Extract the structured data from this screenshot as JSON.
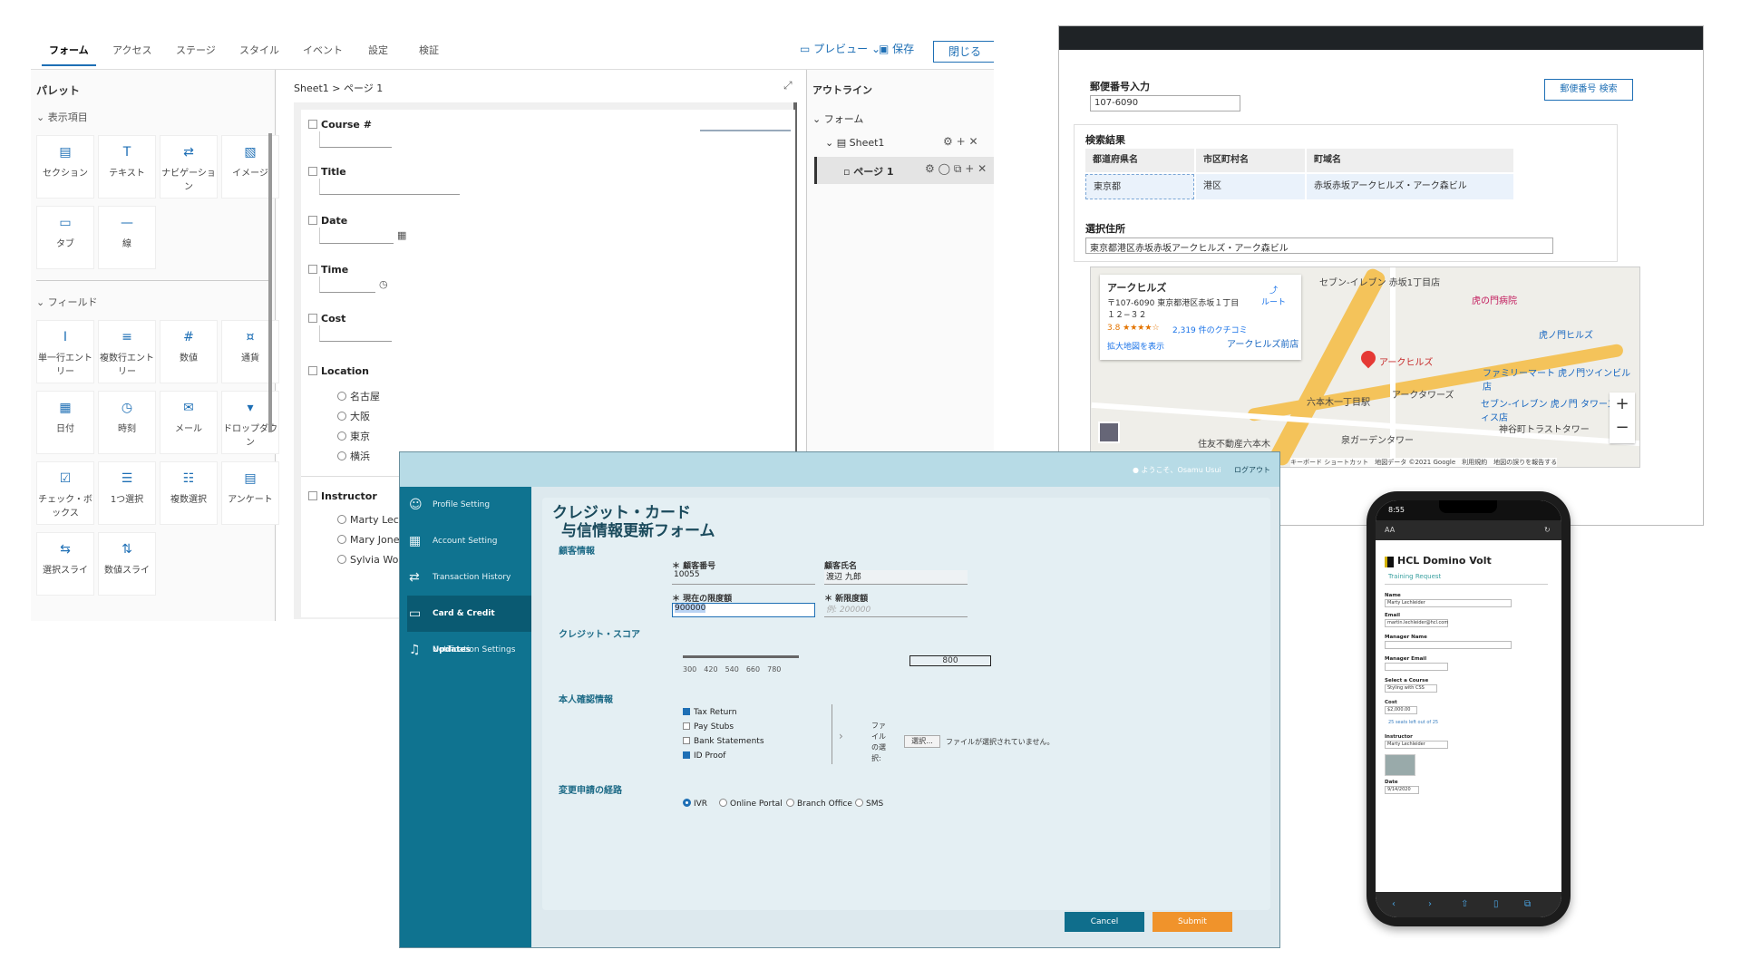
{
  "builder": {
    "tabs": [
      "フォーム",
      "アクセス",
      "ステージ",
      "スタイル",
      "イベント",
      "設定",
      "検証"
    ],
    "preview_label": "プレビュー",
    "save_label": "保存",
    "close_label": "閉じる",
    "palette_title": "パレット",
    "display_section": "表示項目",
    "display_items": [
      "セクション",
      "テキスト",
      "ナビゲーション",
      "イメージ",
      "タブ",
      "線"
    ],
    "field_section": "フィールド",
    "field_items": [
      "単一行エントリー",
      "複数行エントリー",
      "数値",
      "通貨",
      "日付",
      "時刻",
      "メール",
      "ドロップダウン",
      "チェック・ボックス",
      "1つ選択",
      "複数選択",
      "アンケート",
      "選択スライ",
      "数値スライ"
    ],
    "canvas_title": "Sheet1 > ページ 1",
    "fields": [
      "Course #",
      "Title",
      "Date",
      "Time",
      "Cost",
      "Location",
      "Instructor"
    ],
    "location_options": [
      "名古屋",
      "大阪",
      "東京",
      "横浜"
    ],
    "instructor_options": [
      "Marty Lechle",
      "Mary Jones",
      "Sylvia Woods"
    ],
    "outline_title": "アウトライン",
    "outline_items": [
      "フォーム",
      "Sheet1",
      "ページ 1"
    ]
  },
  "postal": {
    "zip_label": "郵便番号入力",
    "zip_value": "107-6090",
    "search_button": "郵便番号 検索",
    "results_title": "検索結果",
    "columns": [
      "都道府県名",
      "市区町村名",
      "町域名"
    ],
    "row": [
      "東京都",
      "港区",
      "赤坂赤坂アークヒルズ・アーク森ビル"
    ],
    "selected_label": "選択住所",
    "selected_value": "東京都港区赤坂赤坂アークヒルズ・アーク森ビル",
    "map_card_title": "アークヒルズ",
    "map_card_address": "〒107-6090 東京都港区赤坂１丁目 １２−３２",
    "map_card_rating": "3.8 ★★★★☆",
    "map_card_reviews": "2,319 件のクチコミ",
    "map_card_link": "拡大地図を表示",
    "map_route": "ルート",
    "map_labels": [
      "セブン-イレブン 赤坂1丁目店",
      "虎の門病院",
      "アークヒルズ",
      "アークタワーズ",
      "ファミリーマート 虎ノ門ツインビル店",
      "六本木一丁目駅",
      "セブン-イレブン 虎ノ門 タワーズオフィス店",
      "神谷町トラストタワー",
      "泉ガーデンタワー",
      "住友不動産六本木",
      "虎ノ門ヒルズ",
      "アークヒルズ前店"
    ],
    "map_footer": "キーボード ショートカット　地図データ ©2021 Google　利用規約　地図の誤りを報告する"
  },
  "credit": {
    "welcome": "ようこそ、Osamu Usui",
    "logout": "ログアウト",
    "nav": [
      "Profile Setting",
      "Account Setting",
      "Transaction History",
      "Card & Credit Updates",
      "Notification Settings"
    ],
    "title1": "クレジット・カード",
    "title2": "与信情報更新フォーム",
    "sec_customer": "顧客情報",
    "lbl_custno": "＊ 顧客番号",
    "custno": "10055",
    "lbl_custname": "顧客氏名",
    "custname": "渡辺 九郎",
    "lbl_limit": "＊ 現在の限度額",
    "limit": "900000",
    "lbl_newlimit": "＊ 新限度額",
    "newlimit_ph": "例: 200000",
    "sec_score": "クレジット・スコア",
    "ticks": [
      "300",
      "420",
      "540",
      "660",
      "780"
    ],
    "score": "800",
    "sec_id": "本人確認情報",
    "docs": [
      {
        "label": "Tax Return",
        "checked": true
      },
      {
        "label": "Pay Stubs",
        "checked": false
      },
      {
        "label": "Bank Statements",
        "checked": false
      },
      {
        "label": "ID Proof",
        "checked": true
      }
    ],
    "file_label": "ファイルの選択:",
    "file_btn": "選択...",
    "file_none": "ファイルが選択されていません。",
    "sec_route": "変更申請の経路",
    "routes": [
      "IVR",
      "Online Portal",
      "Branch Office",
      "SMS"
    ],
    "cancel": "Cancel",
    "submit": "Submit",
    "colors": {
      "sidebar": "#0f7390",
      "cancel": "#0f6e8c",
      "submit": "#f0932b"
    }
  },
  "phone": {
    "time": "8:55",
    "url": "AA",
    "app_title": "HCL Domino Volt",
    "subtitle": "Training Request",
    "fields": [
      {
        "label": "Name",
        "value": "Marty Lechleider"
      },
      {
        "label": "Email",
        "value": "martin.lechleider@hcl.com"
      },
      {
        "label": "Manager Name",
        "value": ""
      },
      {
        "label": "Manager Email",
        "value": ""
      },
      {
        "label": "Select a Course",
        "value": "Styling with CSS"
      },
      {
        "label": "Cost",
        "value": "$2,000.00"
      }
    ],
    "seats": "25 seats left out of 25",
    "instructor_label": "Instructor",
    "instructor": "Marty Lechleider",
    "date_label": "Date",
    "date": "9/14/2020"
  }
}
